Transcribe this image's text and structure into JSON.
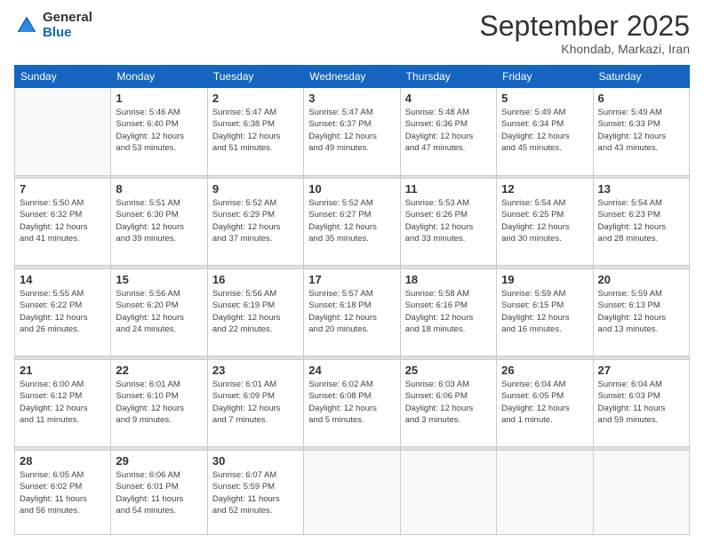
{
  "header": {
    "logo_general": "General",
    "logo_blue": "Blue",
    "title": "September 2025",
    "subtitle": "Khondab, Markazi, Iran"
  },
  "weekdays": [
    "Sunday",
    "Monday",
    "Tuesday",
    "Wednesday",
    "Thursday",
    "Friday",
    "Saturday"
  ],
  "weeks": [
    {
      "days": [
        {
          "num": "",
          "info": ""
        },
        {
          "num": "1",
          "info": "Sunrise: 5:46 AM\nSunset: 6:40 PM\nDaylight: 12 hours\nand 53 minutes."
        },
        {
          "num": "2",
          "info": "Sunrise: 5:47 AM\nSunset: 6:38 PM\nDaylight: 12 hours\nand 51 minutes."
        },
        {
          "num": "3",
          "info": "Sunrise: 5:47 AM\nSunset: 6:37 PM\nDaylight: 12 hours\nand 49 minutes."
        },
        {
          "num": "4",
          "info": "Sunrise: 5:48 AM\nSunset: 6:36 PM\nDaylight: 12 hours\nand 47 minutes."
        },
        {
          "num": "5",
          "info": "Sunrise: 5:49 AM\nSunset: 6:34 PM\nDaylight: 12 hours\nand 45 minutes."
        },
        {
          "num": "6",
          "info": "Sunrise: 5:49 AM\nSunset: 6:33 PM\nDaylight: 12 hours\nand 43 minutes."
        }
      ]
    },
    {
      "days": [
        {
          "num": "7",
          "info": "Sunrise: 5:50 AM\nSunset: 6:32 PM\nDaylight: 12 hours\nand 41 minutes."
        },
        {
          "num": "8",
          "info": "Sunrise: 5:51 AM\nSunset: 6:30 PM\nDaylight: 12 hours\nand 39 minutes."
        },
        {
          "num": "9",
          "info": "Sunrise: 5:52 AM\nSunset: 6:29 PM\nDaylight: 12 hours\nand 37 minutes."
        },
        {
          "num": "10",
          "info": "Sunrise: 5:52 AM\nSunset: 6:27 PM\nDaylight: 12 hours\nand 35 minutes."
        },
        {
          "num": "11",
          "info": "Sunrise: 5:53 AM\nSunset: 6:26 PM\nDaylight: 12 hours\nand 33 minutes."
        },
        {
          "num": "12",
          "info": "Sunrise: 5:54 AM\nSunset: 6:25 PM\nDaylight: 12 hours\nand 30 minutes."
        },
        {
          "num": "13",
          "info": "Sunrise: 5:54 AM\nSunset: 6:23 PM\nDaylight: 12 hours\nand 28 minutes."
        }
      ]
    },
    {
      "days": [
        {
          "num": "14",
          "info": "Sunrise: 5:55 AM\nSunset: 6:22 PM\nDaylight: 12 hours\nand 26 minutes."
        },
        {
          "num": "15",
          "info": "Sunrise: 5:56 AM\nSunset: 6:20 PM\nDaylight: 12 hours\nand 24 minutes."
        },
        {
          "num": "16",
          "info": "Sunrise: 5:56 AM\nSunset: 6:19 PM\nDaylight: 12 hours\nand 22 minutes."
        },
        {
          "num": "17",
          "info": "Sunrise: 5:57 AM\nSunset: 6:18 PM\nDaylight: 12 hours\nand 20 minutes."
        },
        {
          "num": "18",
          "info": "Sunrise: 5:58 AM\nSunset: 6:16 PM\nDaylight: 12 hours\nand 18 minutes."
        },
        {
          "num": "19",
          "info": "Sunrise: 5:59 AM\nSunset: 6:15 PM\nDaylight: 12 hours\nand 16 minutes."
        },
        {
          "num": "20",
          "info": "Sunrise: 5:59 AM\nSunset: 6:13 PM\nDaylight: 12 hours\nand 13 minutes."
        }
      ]
    },
    {
      "days": [
        {
          "num": "21",
          "info": "Sunrise: 6:00 AM\nSunset: 6:12 PM\nDaylight: 12 hours\nand 11 minutes."
        },
        {
          "num": "22",
          "info": "Sunrise: 6:01 AM\nSunset: 6:10 PM\nDaylight: 12 hours\nand 9 minutes."
        },
        {
          "num": "23",
          "info": "Sunrise: 6:01 AM\nSunset: 6:09 PM\nDaylight: 12 hours\nand 7 minutes."
        },
        {
          "num": "24",
          "info": "Sunrise: 6:02 AM\nSunset: 6:08 PM\nDaylight: 12 hours\nand 5 minutes."
        },
        {
          "num": "25",
          "info": "Sunrise: 6:03 AM\nSunset: 6:06 PM\nDaylight: 12 hours\nand 3 minutes."
        },
        {
          "num": "26",
          "info": "Sunrise: 6:04 AM\nSunset: 6:05 PM\nDaylight: 12 hours\nand 1 minute."
        },
        {
          "num": "27",
          "info": "Sunrise: 6:04 AM\nSunset: 6:03 PM\nDaylight: 11 hours\nand 59 minutes."
        }
      ]
    },
    {
      "days": [
        {
          "num": "28",
          "info": "Sunrise: 6:05 AM\nSunset: 6:02 PM\nDaylight: 11 hours\nand 56 minutes."
        },
        {
          "num": "29",
          "info": "Sunrise: 6:06 AM\nSunset: 6:01 PM\nDaylight: 11 hours\nand 54 minutes."
        },
        {
          "num": "30",
          "info": "Sunrise: 6:07 AM\nSunset: 5:59 PM\nDaylight: 11 hours\nand 52 minutes."
        },
        {
          "num": "",
          "info": ""
        },
        {
          "num": "",
          "info": ""
        },
        {
          "num": "",
          "info": ""
        },
        {
          "num": "",
          "info": ""
        }
      ]
    }
  ]
}
